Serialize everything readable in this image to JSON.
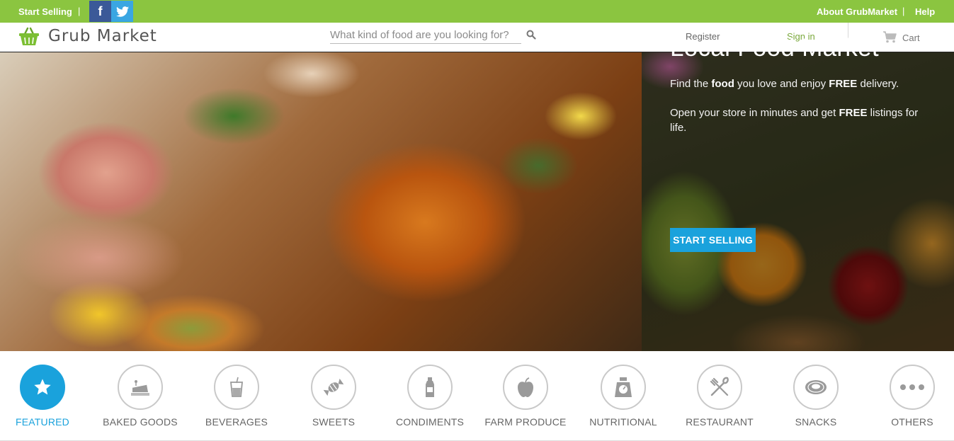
{
  "topbar": {
    "start_selling": "Start Selling",
    "separator": "|",
    "facebook_letter": "f",
    "about": "About GrubMarket",
    "help": "Help"
  },
  "header": {
    "logo_text": "Grub Market",
    "search_placeholder": "What kind of food are you looking for?",
    "register": "Register",
    "signin": "Sign in",
    "cart": "Cart"
  },
  "hero": {
    "title": "Local Food Market",
    "line1_pre": "Find the ",
    "line1_bold1": "food",
    "line1_mid": " you love and enjoy ",
    "line1_bold2": "FREE",
    "line1_post": " delivery.",
    "line2_pre": "Open your store in minutes and get ",
    "line2_bold": "FREE",
    "line2_post": " listings for life.",
    "button": "START SELLING"
  },
  "categories": [
    {
      "label": "FEATURED",
      "icon": "star-icon",
      "active": true
    },
    {
      "label": "BAKED GOODS",
      "icon": "cake-icon",
      "active": false
    },
    {
      "label": "BEVERAGES",
      "icon": "drink-icon",
      "active": false
    },
    {
      "label": "SWEETS",
      "icon": "candy-icon",
      "active": false
    },
    {
      "label": "CONDIMENTS",
      "icon": "bottle-icon",
      "active": false
    },
    {
      "label": "FARM PRODUCE",
      "icon": "apple-icon",
      "active": false
    },
    {
      "label": "NUTRITIONAL",
      "icon": "scale-icon",
      "active": false
    },
    {
      "label": "RESTAURANT",
      "icon": "fork-knife-icon",
      "active": false
    },
    {
      "label": "SNACKS",
      "icon": "donut-icon",
      "active": false
    },
    {
      "label": "OTHERS",
      "icon": "more-dots-icon",
      "active": false
    }
  ],
  "colors": {
    "topbar_green": "#8bc540",
    "accent_blue": "#1aa2dc",
    "signin_green": "#79a83a"
  }
}
